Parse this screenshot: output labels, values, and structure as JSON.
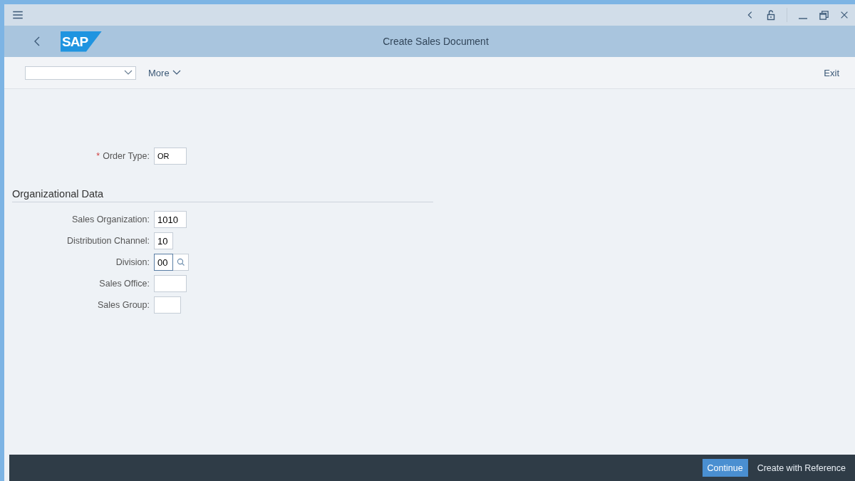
{
  "header": {
    "logo": "SAP",
    "title": "Create Sales Document"
  },
  "toolbar": {
    "more": "More",
    "exit": "Exit"
  },
  "order_type": {
    "label": "Order Type:",
    "value": "OR",
    "required": true,
    "required_mark": "*"
  },
  "section": {
    "title": "Organizational Data"
  },
  "fields": [
    {
      "label": "Sales Organization:",
      "value": "1010",
      "kind": "plain",
      "focused": false
    },
    {
      "label": "Distribution Channel:",
      "value": "10",
      "kind": "plain",
      "focused": false
    },
    {
      "label": "Division:",
      "value": "00",
      "kind": "value_help",
      "focused": true
    },
    {
      "label": "Sales Office:",
      "kind": "plain",
      "focused": false
    },
    {
      "label": "Sales Group:",
      "kind": "plain",
      "focused": false
    }
  ],
  "footer": {
    "buttons": [
      {
        "label": "Continue",
        "emphasized": true
      },
      {
        "label": "Create with Reference",
        "emphasized": false
      }
    ]
  }
}
